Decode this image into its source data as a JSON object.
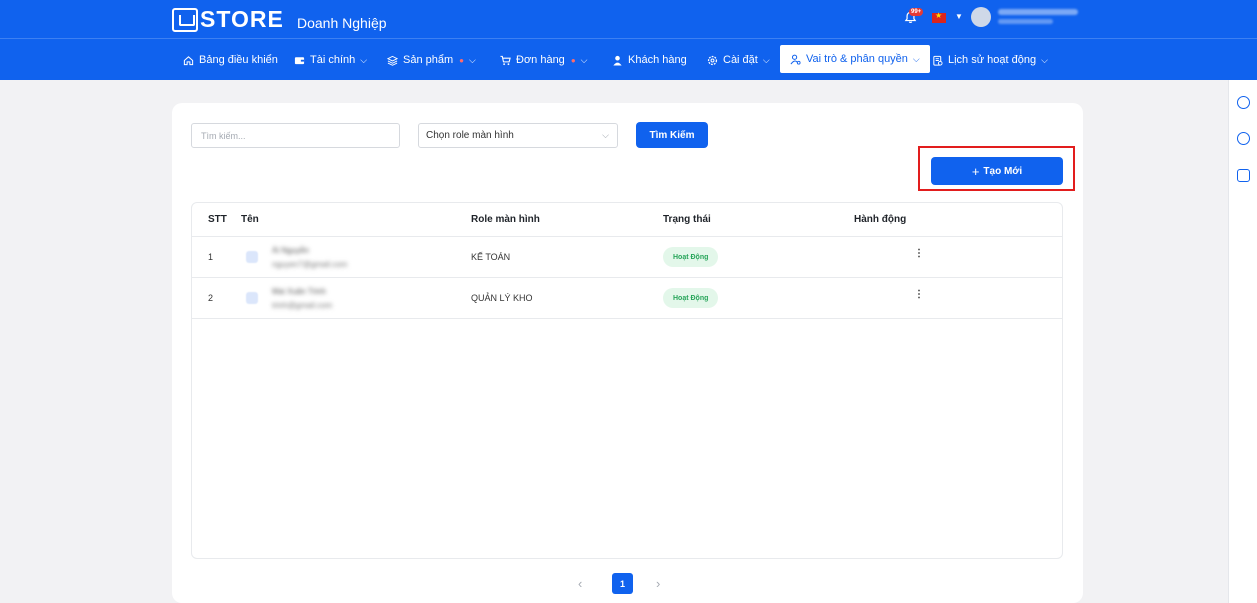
{
  "header": {
    "logo_text": "STORE",
    "subtitle": "Doanh Nghiệp",
    "notification_badge": "99+",
    "user_name": "NGUYỄN VĂN TỨ",
    "user_role": "ADMIN"
  },
  "nav": {
    "items": [
      {
        "label": "Bảng điều khiển",
        "icon": "home-icon"
      },
      {
        "label": "Tài chính",
        "icon": "wallet-icon"
      },
      {
        "label": "Sản phẩm",
        "icon": "layers-icon"
      },
      {
        "label": "Đơn hàng",
        "icon": "cart-icon"
      },
      {
        "label": "Khách hàng",
        "icon": "user-icon"
      },
      {
        "label": "Cài đặt",
        "icon": "gear-icon"
      },
      {
        "label": "Vai trò & phân quyền",
        "icon": "user-role-icon"
      },
      {
        "label": "Lịch sử hoạt động",
        "icon": "history-icon"
      }
    ]
  },
  "filters": {
    "search_placeholder": "Tìm kiếm...",
    "role_select_value": "Chọn role màn hình",
    "search_button": "Tìm Kiếm"
  },
  "actions": {
    "create_button": "Tạo Mới"
  },
  "table": {
    "headers": [
      "STT",
      "Tên",
      "Role màn hình",
      "Trạng thái",
      "Hành động"
    ],
    "rows": [
      {
        "stt": "1",
        "name": "Ái Nguyễn",
        "email": "nguyen7@gmail.com",
        "role": "KẾ TOÁN",
        "status": "Hoạt Động"
      },
      {
        "stt": "2",
        "name": "Mai Xuân Trinh",
        "email": "trinh@gmail.com",
        "role": "QUẢN LÝ KHO",
        "status": "Hoạt Động"
      }
    ]
  },
  "pagination": {
    "current": "1",
    "prev": "‹",
    "next": "›"
  },
  "colors": {
    "primary": "#1062ee",
    "highlight": "#e21d1d",
    "status_active_bg": "#e3f7ea",
    "status_active_text": "#27a55a"
  }
}
